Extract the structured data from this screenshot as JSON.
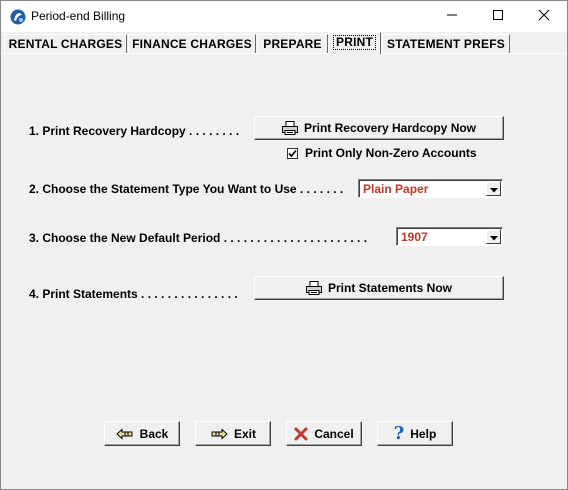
{
  "window": {
    "title": "Period-end Billing"
  },
  "tabs": [
    {
      "label": "RENTAL CHARGES"
    },
    {
      "label": "FINANCE CHARGES"
    },
    {
      "label": "PREPARE"
    },
    {
      "label": "PRINT"
    },
    {
      "label": "STATEMENT PREFS"
    }
  ],
  "step1": {
    "label": "1. Print Recovery Hardcopy . . . . . . . .",
    "button": "Print Recovery Hardcopy Now",
    "checkbox_label": "Print Only Non-Zero Accounts",
    "checkbox_checked": true
  },
  "step2": {
    "label": "2. Choose the Statement Type You Want to Use . . . . . . .",
    "value": "Plain Paper"
  },
  "step3": {
    "label": "3. Choose the New Default Period . . . . . . . . . . . . . . . . . . . . . .",
    "value": "1907"
  },
  "step4": {
    "label": "4. Print Statements . . . . . . . . . . . . . . .",
    "button": "Print Statements Now"
  },
  "footer": {
    "back": "Back",
    "exit": "Exit",
    "cancel": "Cancel",
    "help": "Help"
  },
  "colors": {
    "combo_value": "#c0392b",
    "cancel_icon": "#c0392b",
    "help_icon": "#1565c0"
  }
}
